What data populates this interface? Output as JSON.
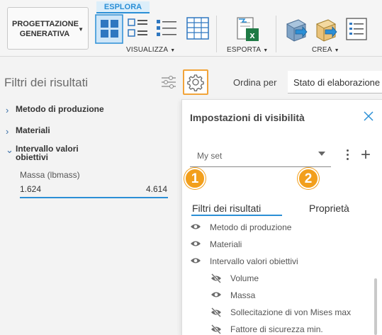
{
  "toolbar": {
    "active_tab": "ESPLORA",
    "generative_button": {
      "line1": "PROGETTAZIONE",
      "line2": "GENERATIVA"
    },
    "groups": [
      {
        "label": "VISUALIZZA",
        "icons": [
          "grid-view-icon",
          "list-thumbnail-view-icon",
          "properties-list-view-icon",
          "table-view-icon"
        ]
      },
      {
        "label": "ESPORTA",
        "icons": [
          "excel-export-icon"
        ]
      },
      {
        "label": "CREA",
        "icons": [
          "create-design-icon",
          "create-3d-icon",
          "create-list-icon"
        ]
      }
    ]
  },
  "left_panel": {
    "title": "Filtri dei risultati",
    "items": [
      {
        "label": "Metodo di produzione",
        "expanded": false
      },
      {
        "label": "Materiali",
        "expanded": false
      },
      {
        "label_line1": "Intervallo valori",
        "label_line2": "obiettivi",
        "expanded": true
      }
    ],
    "range": {
      "label": "Massa (lbmass)",
      "min": "1.624",
      "max": "4.614"
    }
  },
  "sort": {
    "label": "Ordina per",
    "value": "Stato di elaborazione"
  },
  "popup": {
    "title": "Impostazioni di visibilità",
    "set_select": {
      "value": "My set"
    },
    "badges": [
      "1",
      "2"
    ],
    "tabs": [
      {
        "label": "Filtri dei risultati",
        "active": true
      },
      {
        "label": "Proprietà",
        "active": false
      }
    ],
    "rows": [
      {
        "label": "Metodo di produzione",
        "visible": true,
        "indent": 0
      },
      {
        "label": "Materiali",
        "visible": true,
        "indent": 0
      },
      {
        "label": "Intervallo valori obiettivi",
        "visible": true,
        "indent": 0
      },
      {
        "label": "Volume",
        "visible": false,
        "indent": 1
      },
      {
        "label": "Massa",
        "visible": true,
        "indent": 1
      },
      {
        "label": "Sollecitazione di von Mises max",
        "visible": false,
        "indent": 1
      },
      {
        "label": "Fattore di sicurezza min.",
        "visible": false,
        "indent": 1
      }
    ]
  },
  "colors": {
    "accent": "#2b8fd6",
    "badge": "#f29f1c",
    "excel": "#1f7a45"
  }
}
